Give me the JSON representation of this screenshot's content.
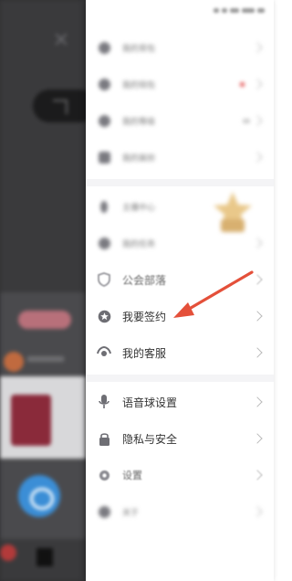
{
  "drawer": {
    "sections": [
      {
        "items": [
          {
            "label": "我的背包",
            "icon": "circle-icon",
            "blurred": true
          },
          {
            "label": "我的钱包",
            "icon": "circle-icon",
            "blurred": true,
            "badge": "red-dot"
          },
          {
            "label": "我的等级",
            "icon": "circle-icon",
            "blurred": true
          },
          {
            "label": "我的装扮",
            "icon": "tv-icon",
            "blurred": true
          }
        ]
      },
      {
        "items": [
          {
            "label": "主播中心",
            "icon": "bolt-icon",
            "blurred": true
          },
          {
            "label": "我的任务",
            "icon": "circle-icon",
            "blurred": true
          },
          {
            "label": "公会部落",
            "icon": "shield-icon",
            "blurred": false
          },
          {
            "label": "我要签约",
            "icon": "star-icon",
            "blurred": false
          },
          {
            "label": "我的客服",
            "icon": "headset-icon",
            "blurred": false
          }
        ]
      },
      {
        "items": [
          {
            "label": "语音球设置",
            "icon": "mic-icon",
            "blurred": false
          },
          {
            "label": "隐私与安全",
            "icon": "lock-icon",
            "blurred": false
          },
          {
            "label": "设置",
            "icon": "gear-icon",
            "blurred": false
          },
          {
            "label": "关于",
            "icon": "info-icon",
            "blurred": true
          }
        ]
      }
    ]
  },
  "annotation": {
    "color": "#e4503a",
    "target": "我要签约"
  },
  "colors": {
    "drawer_bg": "#ffffff",
    "divider": "#f4f4f6",
    "text": "#333333",
    "icon": "#6e6e74"
  }
}
